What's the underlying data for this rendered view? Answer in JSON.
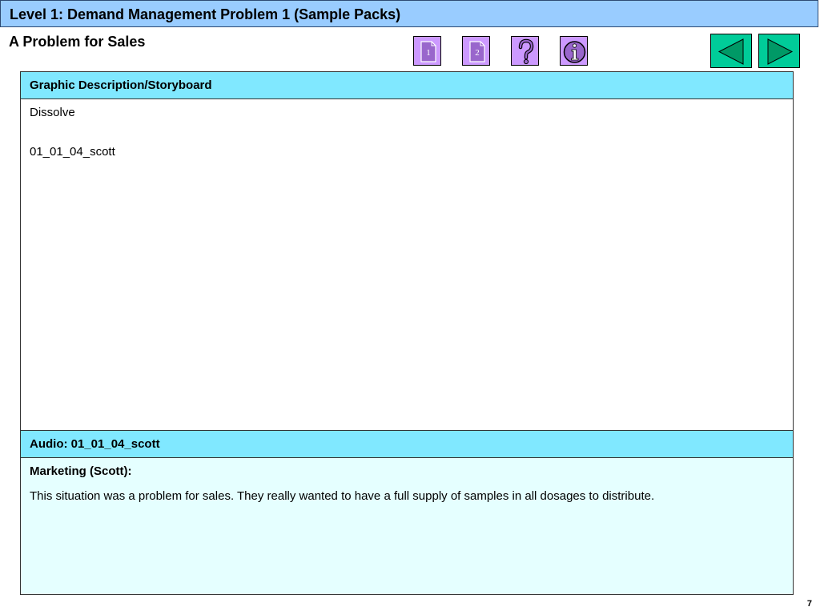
{
  "header": {
    "title": "Level 1: Demand Management Problem 1 (Sample Packs)"
  },
  "subtitle": "A Problem for Sales",
  "toolbar": {
    "buttons": [
      {
        "icon": "page-1-icon",
        "label": "1"
      },
      {
        "icon": "page-2-icon",
        "label": "2"
      },
      {
        "icon": "help-icon"
      },
      {
        "icon": "info-icon"
      }
    ],
    "prev_icon": "triangle-left-icon",
    "next_icon": "triangle-right-icon"
  },
  "graphic": {
    "header": "Graphic Description/Storyboard",
    "lines": [
      "Dissolve",
      "01_01_04_scott"
    ]
  },
  "audio": {
    "header": "Audio: 01_01_04_scott",
    "speaker": "Marketing (Scott):",
    "text": "This situation was a problem for sales. They really wanted to have a full supply of samples in all dosages to distribute."
  },
  "page_number": "7",
  "colors": {
    "title_bar": "#99ccff",
    "section_header": "#80e8ff",
    "audio_body": "#e5ffff",
    "nav_button": "#cc99ff",
    "arrow_button": "#00cc99",
    "arrow_fill": "#009966"
  }
}
